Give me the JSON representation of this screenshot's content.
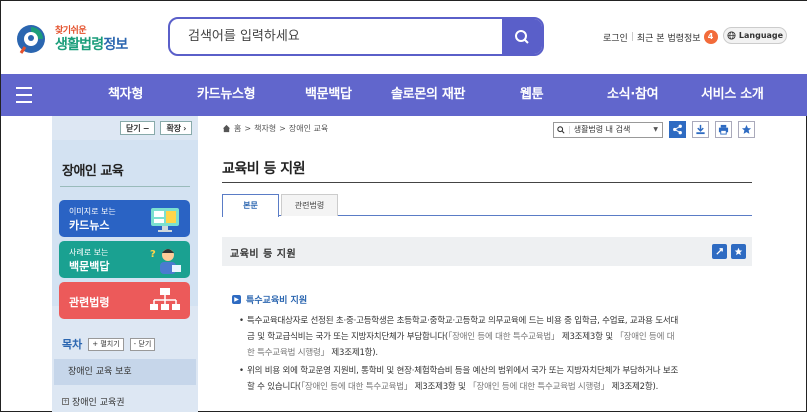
{
  "header": {
    "logo_small": "찾기쉬운",
    "logo_big_1": "생활법령",
    "logo_big_2": "정보",
    "search_placeholder": "검색어를 입력하세요",
    "login": "로그인",
    "recent": "최근 본 법령정보",
    "recent_count": "4",
    "language": "Language"
  },
  "nav": {
    "items": [
      "책자형",
      "카드뉴스형",
      "백문백답",
      "솔로몬의 재판",
      "웹툰",
      "소식·참여",
      "서비스 소개"
    ]
  },
  "sidebar": {
    "collapse": "닫기",
    "expand": "확장",
    "title": "장애인 교육",
    "cards": [
      {
        "line1": "이미지로 보는",
        "line2": "카드뉴스"
      },
      {
        "line1": "사례로 보는",
        "line2": "백문백답"
      },
      {
        "line1": "",
        "line2": "관련법령"
      }
    ],
    "toc_title": "목차",
    "toc_expand": "+ 펼치기",
    "toc_collapse": "- 닫기",
    "toc_items": [
      "장애인 교육 보호",
      "장애인 교육권"
    ]
  },
  "main": {
    "breadcrumb": [
      "홈",
      "책자형",
      "장애인 교육"
    ],
    "search_select": "생활법령 내 검색",
    "page_title": "교육비 등 지원",
    "tabs": [
      "본문",
      "관련법령"
    ],
    "section_title": "교육비 등 지원",
    "sub_heading": "특수교육비 지원",
    "para1_line1": "특수교육대상자로 선정된 초·중·고등학생은 초등학교·중학교·고등학교 의무교육에 드는 비용 중 입학금, 수업료, 교과용 도서대",
    "para1_line2_a": "금 및 학교급식비는 국가 또는 지방자치단체가 부담합니다(",
    "para1_ref1": "「장애인 등에 대한 특수교육법」",
    "para1_line2_b": " 제3조제3항 및 ",
    "para1_ref2": "「장애인 등에 대",
    "para1_line3_ref": "한 특수교육법 시행령」",
    "para1_line3_b": " 제3조제1항).",
    "para2_line1": "위의 비용 외에 학교운영 지원비, 통학비 및 현장·체험학습비 등을 예산의 범위에서 국가 또는 지방자치단체가 부담하거나 보조",
    "para2_line2_a": "할 수 있습니다(",
    "para2_ref1": "「장애인 등에 대한 특수교육법」",
    "para2_line2_b": " 제3조제3항 및 ",
    "para2_ref2": "「장애인 등에 대한 특수교육법 시행령」",
    "para2_line2_c": " 제3조제2항)."
  },
  "colors": {
    "brand_purple": "#6166cc",
    "accent_blue": "#2e6bc2",
    "badge_orange": "#f26b3a",
    "card_blue": "#2a63c4",
    "card_teal": "#1aa191",
    "card_red": "#ec5a5a"
  }
}
